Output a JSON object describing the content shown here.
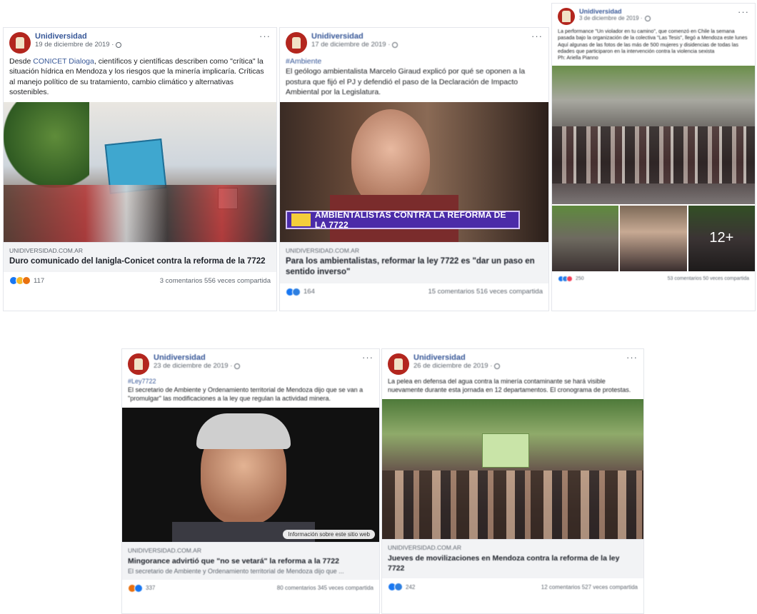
{
  "posts": [
    {
      "page": "Unidiversidad",
      "date": "19 de diciembre de 2019 ·",
      "text_pre": "Desde ",
      "text_link": "CONICET Dialoga",
      "text_post": ", científicos y científicas describen como \"crítica\" la situación hídrica en Mendoza y los riesgos que la minería implicaría. Críticas al manejo político de su tratamiento, cambio climático y alternativas sostenibles.",
      "domain": "UNIDIVERSIDAD.COM.AR",
      "headline": "Duro comunicado del Ianigla-Conicet contra la reforma de la 7722",
      "reactions": "117",
      "comments": "3 comentarios",
      "shares": "556 veces compartida"
    },
    {
      "page": "Unidiversidad",
      "date": "17 de diciembre de 2019 ·",
      "hashtag": "#Ambiente",
      "text": "El geólogo ambientalista Marcelo Giraud explicó por qué se oponen a la postura que fijó el PJ y defendió el paso de la Declaración de Impacto Ambiental por la Legislatura.",
      "overlay": "AMBIENTALISTAS CONTRA LA REFORMA DE LA 7722",
      "domain": "UNIDIVERSIDAD.COM.AR",
      "headline": "Para los ambientalistas, reformar la ley 7722 es \"dar un paso en sentido inverso\"",
      "reactions": "164",
      "comments": "15 comentarios",
      "shares": "516 veces compartida"
    },
    {
      "page": "Unidiversidad",
      "date": "3 de diciembre de 2019 ·",
      "text": "La performance \"Un violador en tu camino\", que comenzó en Chile la semana pasada bajo la organización de la colectiva \"Las Tesis\", llegó a Mendoza este lunes",
      "text2": "Aquí algunas de las fotos de las más de 500 mujeres y disidencias de todas las edades que participaron en la intervención contra la violencia sexista",
      "credit": "Ph: Ariella Pianno",
      "more_photos": "12+",
      "reactions": "250",
      "comments": "53 comentarios",
      "shares": "50 veces compartida"
    },
    {
      "page": "Unidiversidad",
      "date": "23 de diciembre de 2019 ·",
      "hashtag": "#Ley7722",
      "text": "El secretario de Ambiente y Ordenamiento territorial de Mendoza dijo que se van a \"promulgar\" las modificaciones a la ley que regulan la actividad minera.",
      "info": "Información sobre este sitio web",
      "domain": "UNIDIVERSIDAD.COM.AR",
      "headline": "Mingorance advirtió que \"no se vetará\" la reforma a la 7722",
      "subline": "El secretario de Ambiente y Ordenamiento territorial de Mendoza dijo que ...",
      "reactions": "337",
      "comments": "80 comentarios",
      "shares": "345 veces compartida"
    },
    {
      "page": "Unidiversidad",
      "date": "26 de diciembre de 2019 ·",
      "text": "La pelea en defensa del agua contra la minería contaminante se hará visible nuevamente durante esta jornada en 12 departamentos. El cronograma de protestas.",
      "domain": "UNIDIVERSIDAD.COM.AR",
      "headline": "Jueves de movilizaciones en Mendoza contra la reforma de la ley 7722",
      "reactions": "242",
      "comments": "12 comentarios",
      "shares": "527 veces compartida"
    }
  ],
  "icons": [
    "avatar-logo",
    "globe-icon",
    "more-icon",
    "like-reaction",
    "sad-reaction",
    "angry-reaction",
    "love-reaction"
  ],
  "colors": {
    "link": "#385898",
    "page_name": "#385898",
    "muted": "#606770",
    "link_bar": "#f2f3f5",
    "like": "#1877f2"
  }
}
